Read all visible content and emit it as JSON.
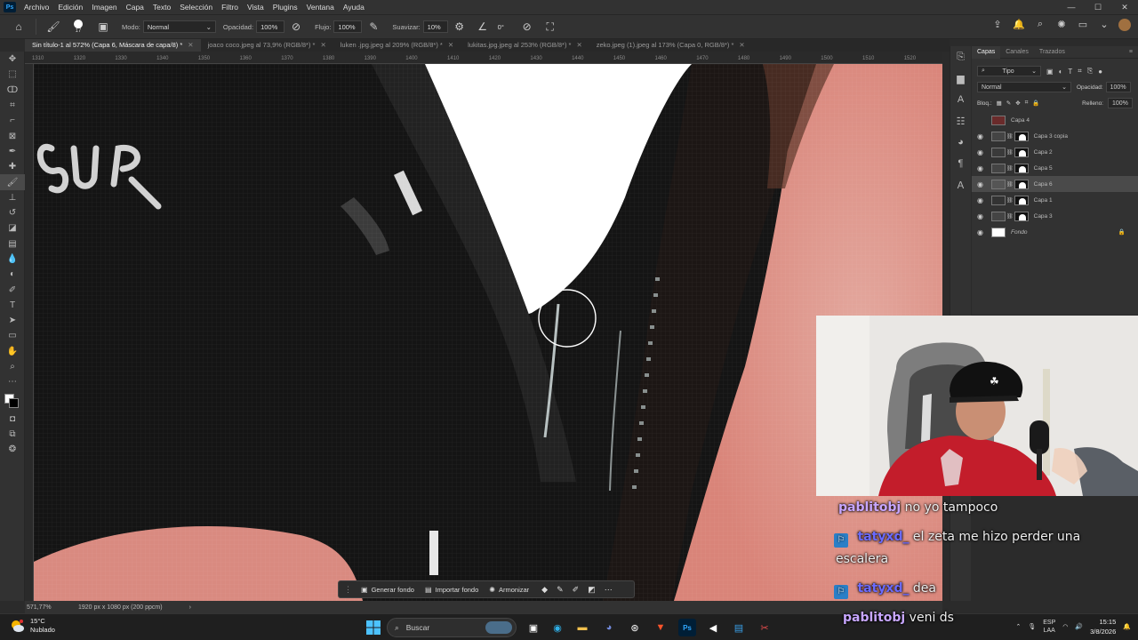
{
  "menu": {
    "app_icon": "Ps",
    "items": [
      "Archivo",
      "Edición",
      "Imagen",
      "Capa",
      "Texto",
      "Selección",
      "Filtro",
      "Vista",
      "Plugins",
      "Ventana",
      "Ayuda"
    ],
    "window_controls": [
      "—",
      "☐",
      "✕"
    ]
  },
  "options_bar": {
    "brush_size": "17",
    "modo_label": "Modo:",
    "modo_value": "Normal",
    "opacidad_label": "Opacidad:",
    "opacidad_value": "100%",
    "flujo_label": "Flujo:",
    "flujo_value": "100%",
    "suavizar_label": "Suavizar:",
    "suavizar_value": "10%",
    "angle_value": "0°"
  },
  "tabs": [
    {
      "label": "Sin título-1 al 572% (Capa 6, Máscara de capa/8) *",
      "active": true
    },
    {
      "label": "joaco coco.jpeg al 73,9% (RGB/8*) *",
      "active": false
    },
    {
      "label": "luken .jpg.jpeg al 209% (RGB/8*) *",
      "active": false
    },
    {
      "label": "lukitas.jpg.jpeg al 253% (RGB/8*) *",
      "active": false
    },
    {
      "label": "zeko.jpeg (1).jpeg al 173% (Capa 0, RGB/8*) *",
      "active": false
    }
  ],
  "ruler_ticks": [
    "1310",
    "1320",
    "1330",
    "1340",
    "1350",
    "1360",
    "1370",
    "1380",
    "1390",
    "1400",
    "1410",
    "1420",
    "1430",
    "1440",
    "1450",
    "1460",
    "1470",
    "1480",
    "1490",
    "1500",
    "1510",
    "1520"
  ],
  "status": {
    "zoom": "571,77%",
    "doc_size": "1920 px x 1080 px (200 ppcm)"
  },
  "context_bar": {
    "generar": "Generar fondo",
    "importar": "Importar fondo",
    "armonizar": "Armonizar"
  },
  "layers_panel": {
    "tabs": [
      "Capas",
      "Canales",
      "Trazados"
    ],
    "filter_label": "Tipo",
    "blend_mode": "Normal",
    "opacidad_label": "Opacidad:",
    "opacidad_value": "100%",
    "bloq_label": "Bloq.:",
    "relleno_label": "Relleno:",
    "relleno_value": "100%",
    "layers": [
      {
        "name": "Capa 4",
        "visible": false,
        "mask": false,
        "selected": false,
        "thumb": "#6a2b2b"
      },
      {
        "name": "Capa 3 copia",
        "visible": true,
        "mask": true,
        "selected": false,
        "thumb": "#444"
      },
      {
        "name": "Capa 2",
        "visible": true,
        "mask": true,
        "selected": false,
        "thumb": "#3a3a3a"
      },
      {
        "name": "Capa 5",
        "visible": true,
        "mask": true,
        "selected": false,
        "thumb": "#444"
      },
      {
        "name": "Capa 6",
        "visible": true,
        "mask": true,
        "selected": true,
        "thumb": "#555"
      },
      {
        "name": "Capa 1",
        "visible": true,
        "mask": true,
        "selected": false,
        "thumb": "#333"
      },
      {
        "name": "Capa 3",
        "visible": true,
        "mask": true,
        "selected": false,
        "thumb": "#444"
      },
      {
        "name": "Fondo",
        "visible": true,
        "mask": false,
        "selected": false,
        "thumb": "#ffffff",
        "locked": true
      }
    ]
  },
  "chat": [
    {
      "user": "pablitobj",
      "text": "no yo tampoco",
      "badge": false,
      "user_color": "#c7a6ff"
    },
    {
      "user": "tatyxd_",
      "text": "el zeta me hizo perder una",
      "text2": "escalera",
      "badge": true,
      "user_color": "#6b6bff"
    },
    {
      "user": "tatyxd_",
      "text": "dea",
      "badge": true,
      "user_color": "#6b6bff"
    },
    {
      "user": "pablitobj",
      "text": "veni ds",
      "badge": false,
      "user_color": "#c7a6ff"
    }
  ],
  "taskbar": {
    "temp": "15°C",
    "weather": "Nublado",
    "search_placeholder": "Buscar",
    "lang1": "ESP",
    "lang2": "LAA",
    "time": "15:15",
    "date": "3/8/2026"
  },
  "colors": {
    "accent": "#31a8ff",
    "panel": "#323232",
    "selected_layer": "#4a4a4a",
    "skin": "#d98a80"
  }
}
